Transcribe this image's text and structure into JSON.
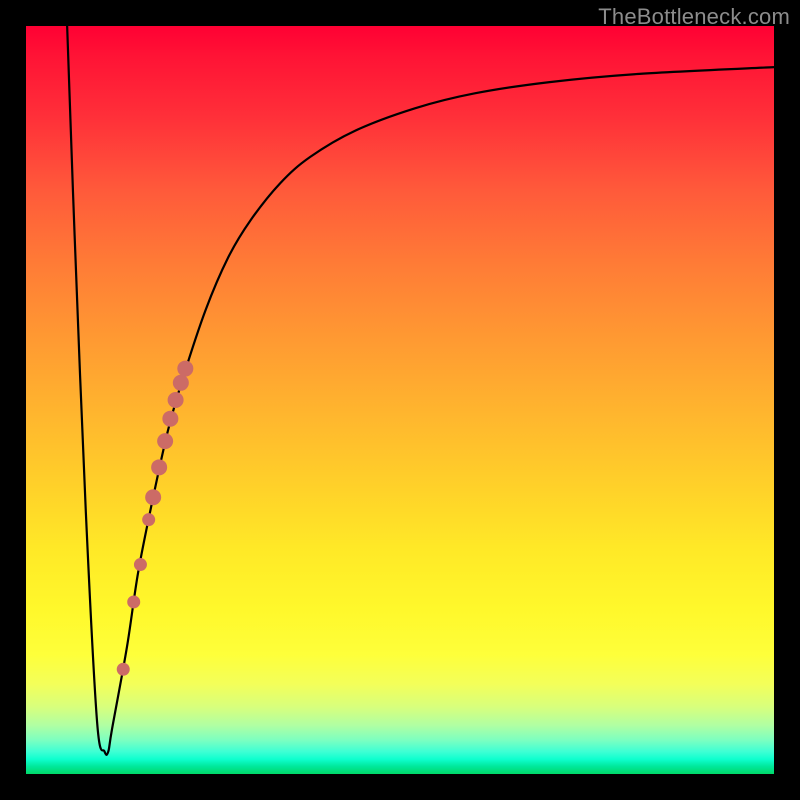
{
  "source_label": "TheBottleneck.com",
  "colors": {
    "curve": "#000000",
    "marker": "#cc6b66",
    "frame": "#000000"
  },
  "chart_data": {
    "type": "line",
    "title": "",
    "xlabel": "",
    "ylabel": "",
    "xlim": [
      0,
      100
    ],
    "ylim": [
      0,
      100
    ],
    "curve": {
      "x": [
        5.5,
        6.5,
        8.0,
        9.5,
        10.5,
        11.0,
        11.5,
        13.5,
        15.0,
        17.0,
        19.0,
        21.0,
        24.0,
        27.0,
        30.0,
        34.0,
        38.0,
        44.0,
        52.0,
        60.0,
        70.0,
        82.0,
        100.0
      ],
      "y": [
        100,
        72,
        35,
        7,
        3,
        3,
        6,
        17,
        27,
        37,
        46,
        53,
        62,
        69,
        74,
        79,
        82.5,
        86,
        89,
        91,
        92.5,
        93.6,
        94.5
      ]
    },
    "markers": [
      {
        "x": 13.0,
        "y": 14
      },
      {
        "x": 14.4,
        "y": 23
      },
      {
        "x": 15.3,
        "y": 28
      },
      {
        "x": 16.4,
        "y": 34
      },
      {
        "x": 17.0,
        "y": 37
      },
      {
        "x": 17.8,
        "y": 41
      },
      {
        "x": 18.6,
        "y": 44.5
      },
      {
        "x": 19.3,
        "y": 47.5
      },
      {
        "x": 20.0,
        "y": 50
      },
      {
        "x": 20.7,
        "y": 52.3
      },
      {
        "x": 21.3,
        "y": 54.2
      }
    ]
  }
}
